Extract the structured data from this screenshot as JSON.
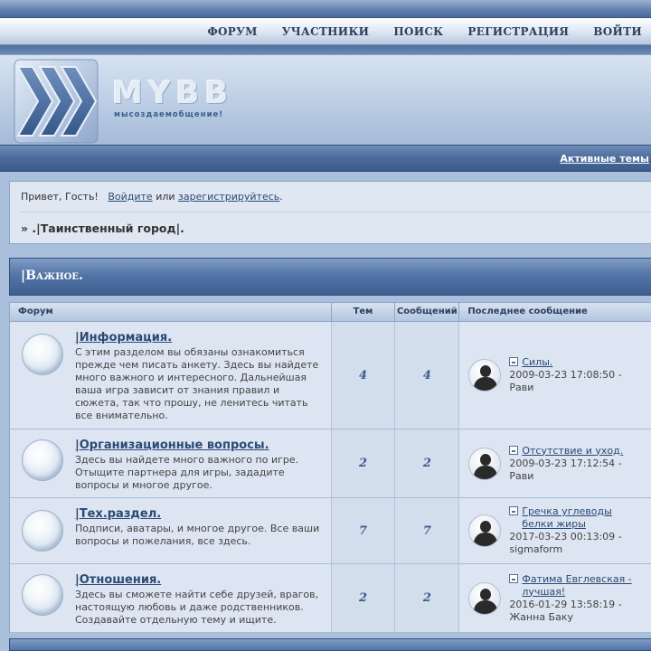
{
  "nav": {
    "items": [
      "ФОРУМ",
      "УЧАСТНИКИ",
      "ПОИСК",
      "РЕГИСТРАЦИЯ",
      "ВОЙТИ"
    ]
  },
  "header": {
    "logo_title": "MYBB",
    "logo_slogan": "мысоздаемобщение!"
  },
  "subbar": {
    "active_topics": "Активные темы"
  },
  "welcome": {
    "greeting": "Привет, Гость!",
    "login_link": "Войдите",
    "or_text": "или",
    "register_link": "зарегистрируйтесь",
    "period": ".",
    "breadcrumb": "» .|Таинственный город|."
  },
  "category": {
    "title": "|Важное."
  },
  "table": {
    "headers": {
      "forum": "Форум",
      "topics": "Тем",
      "posts": "Сообщений",
      "last": "Последнее сообщение"
    },
    "rows": [
      {
        "name": "|Информация.",
        "desc": "С этим разделом вы обязаны ознакомиться прежде чем писать анкету. Здесь вы найдете много важного и интересного. Дальнейшая ваша игра зависит от знания правил и сюжета, так что прошу, не ленитесь читать все внимательно.",
        "topics": "4",
        "posts": "4",
        "last_title": "Силы.",
        "last_date": "2009-03-23 17:08:50 -",
        "last_author": "Рави"
      },
      {
        "name": "|Организационные вопросы.",
        "desc": "Здесь вы найдете много важного по игре. Отыщите партнера для игры, зададите вопросы и многое другое.",
        "topics": "2",
        "posts": "2",
        "last_title": "Отсутствие и уход.",
        "last_date": "2009-03-23 17:12:54 -",
        "last_author": "Рави"
      },
      {
        "name": "|Тех.раздел.",
        "desc": "Подписи, аватары, и многое другое. Все ваши вопросы и пожелания, все здесь.",
        "topics": "7",
        "posts": "7",
        "last_title": "Гречка углеводы белки жиры",
        "last_date": "2017-03-23 00:13:09 -",
        "last_author": "sigmaform"
      },
      {
        "name": "|Отношения.",
        "desc": "Здесь вы сможете найти себе друзей, врагов, настоящую любовь и даже родственников. Создавайте отдельную тему и ищите.",
        "topics": "2",
        "posts": "2",
        "last_title": "Фатима Евглевская - лучшая!",
        "last_date": "2016-01-29 13:58:19 -",
        "last_author": "Жанна Баку"
      }
    ]
  }
}
